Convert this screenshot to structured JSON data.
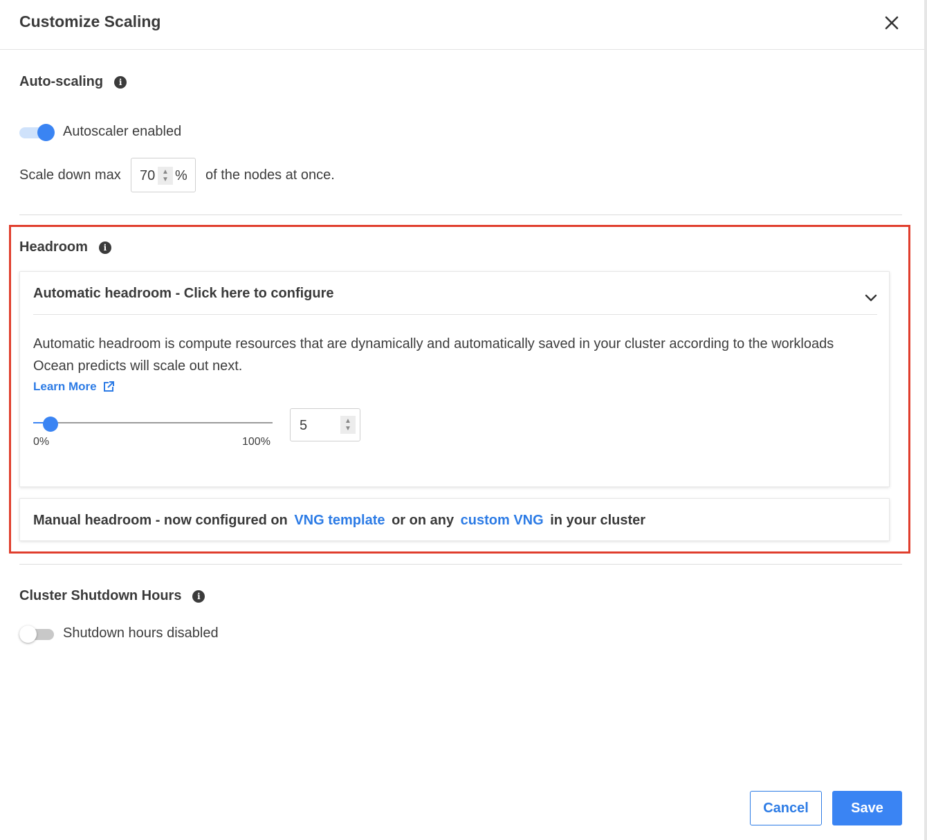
{
  "dialog": {
    "title": "Customize Scaling"
  },
  "autoscaling": {
    "title": "Auto-scaling",
    "toggle_label": "Autoscaler enabled",
    "toggle_on": true,
    "scale_down_prefix": "Scale down max",
    "scale_down_value": "70",
    "scale_down_unit": "%",
    "scale_down_suffix": "of the nodes at once."
  },
  "headroom": {
    "title": "Headroom",
    "automatic": {
      "title": "Automatic headroom - Click here to configure",
      "description": "Automatic headroom is compute resources that are dynamically and automatically saved in your cluster according to the workloads Ocean predicts will scale out next.",
      "learn_more": "Learn More",
      "slider_min_label": "0%",
      "slider_max_label": "100%",
      "slider_value": 5,
      "value": "5"
    },
    "manual": {
      "prefix": "Manual headroom - now configured on",
      "link1": "VNG template",
      "middle": "or on any",
      "link2": "custom VNG",
      "suffix": "in your cluster"
    }
  },
  "shutdown": {
    "title": "Cluster Shutdown Hours",
    "toggle_label": "Shutdown hours disabled",
    "toggle_on": false
  },
  "footer": {
    "cancel_label": "Cancel",
    "save_label": "Save"
  },
  "colors": {
    "accent": "#3a84f3",
    "link": "#2c7be5",
    "highlight_border": "#e03e2d"
  }
}
